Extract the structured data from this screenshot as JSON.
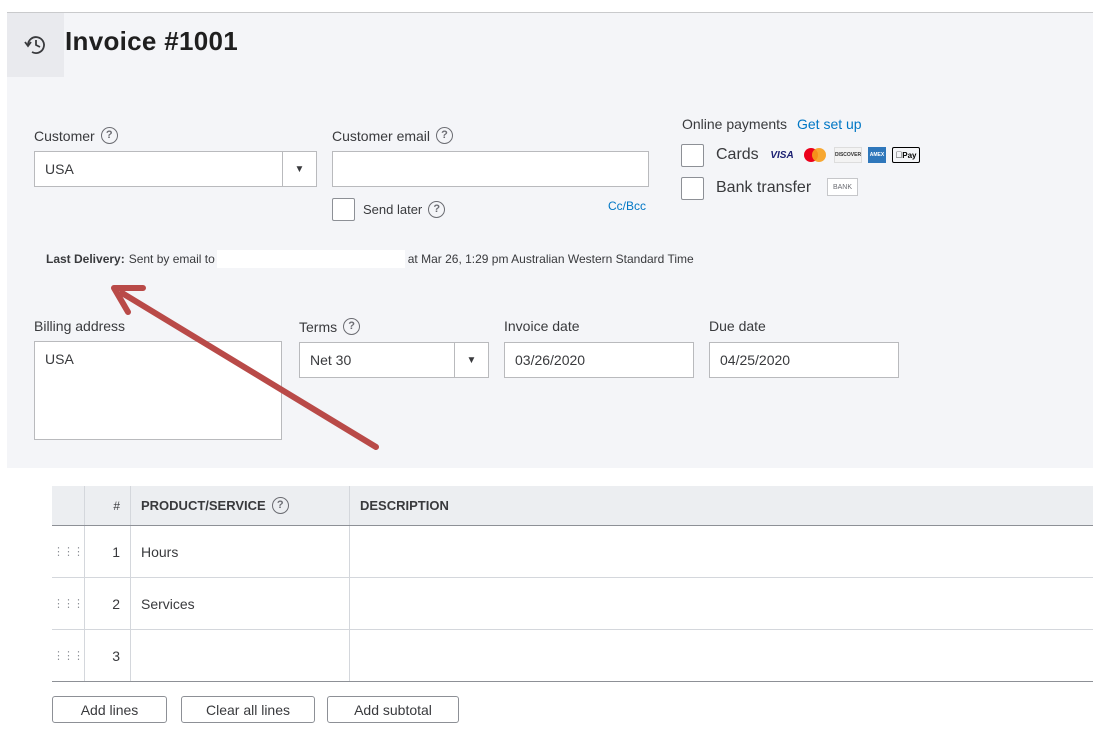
{
  "header": {
    "title": "Invoice #1001",
    "history_icon": "history-clock-icon"
  },
  "customer": {
    "label": "Customer",
    "value": "USA"
  },
  "customer_email": {
    "label": "Customer email",
    "value": "",
    "cc_bcc": "Cc/Bcc"
  },
  "send_later": {
    "label": "Send later"
  },
  "online_payments": {
    "label": "Online payments",
    "setup_link": "Get set up",
    "cards_label": "Cards",
    "card_logos": [
      "VISA",
      "MC",
      "DISCOVER",
      "AMEX",
      "Pay"
    ],
    "bank_label": "Bank transfer",
    "bank_badge": "BANK"
  },
  "last_delivery": {
    "label": "Last Delivery:",
    "prefix": "Sent by email to",
    "suffix": "at Mar 26, 1:29 pm Australian Western Standard Time"
  },
  "billing": {
    "label": "Billing address",
    "value": "USA"
  },
  "terms": {
    "label": "Terms",
    "value": "Net 30"
  },
  "invoice_date": {
    "label": "Invoice date",
    "value": "03/26/2020"
  },
  "due_date": {
    "label": "Due date",
    "value": "04/25/2020"
  },
  "table": {
    "headers": {
      "num": "#",
      "product": "PRODUCT/SERVICE",
      "description": "DESCRIPTION"
    },
    "rows": [
      {
        "num": "1",
        "product": "Hours",
        "description": ""
      },
      {
        "num": "2",
        "product": "Services",
        "description": ""
      },
      {
        "num": "3",
        "product": "",
        "description": ""
      }
    ]
  },
  "actions": {
    "add_lines": "Add lines",
    "clear_all": "Clear all lines",
    "add_subtotal": "Add subtotal"
  },
  "colors": {
    "link": "#0077c5",
    "panel": "#f4f5f8",
    "annotation_arrow": "#b94a48"
  }
}
